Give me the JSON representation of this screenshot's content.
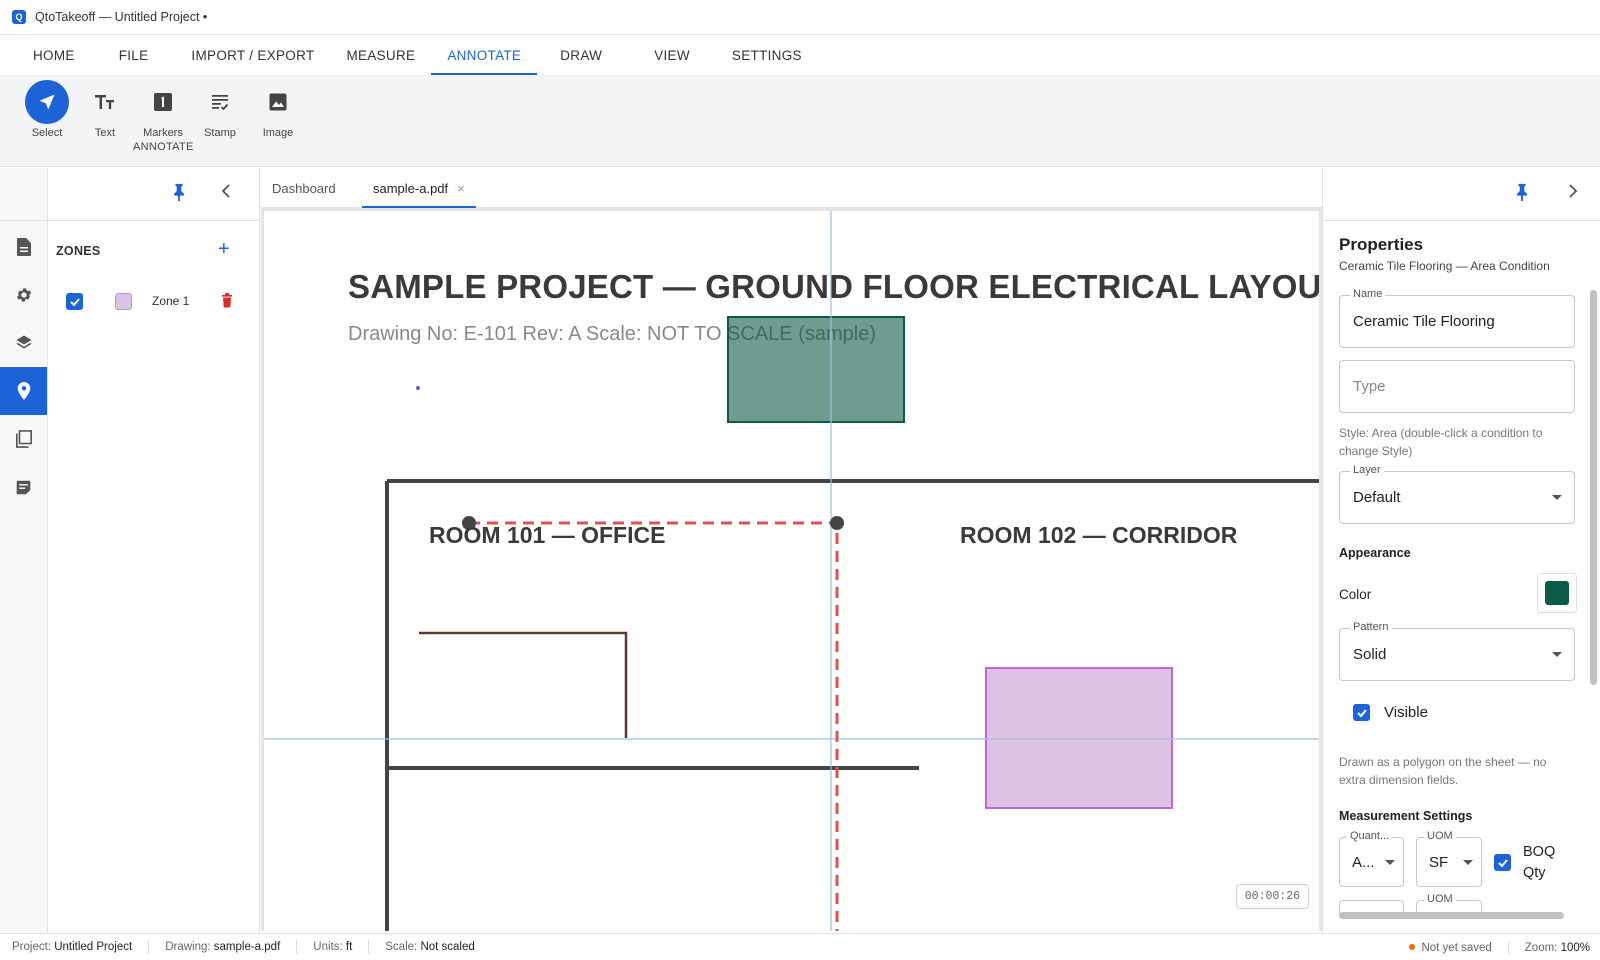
{
  "window": {
    "title": "QtoTakeoff — Untitled Project •",
    "logo_letter": "Q"
  },
  "menu": {
    "tabs": [
      "HOME",
      "FILE",
      "IMPORT / EXPORT",
      "MEASURE",
      "ANNOTATE",
      "DRAW",
      "VIEW",
      "SETTINGS"
    ],
    "active": "ANNOTATE"
  },
  "ribbon": {
    "group_label": "ANNOTATE",
    "buttons": [
      {
        "label": "Select",
        "icon": "navigation-arrow-icon",
        "active": true
      },
      {
        "label": "Text",
        "icon": "text-size-icon"
      },
      {
        "label": "Markers",
        "icon": "marker-1-icon"
      },
      {
        "label": "Stamp",
        "icon": "stamp-icon"
      },
      {
        "label": "Image",
        "icon": "image-icon"
      }
    ]
  },
  "left_rail": {
    "items": [
      "document-icon",
      "settings-icon",
      "layers-icon",
      "location-pin-icon",
      "pages-icon",
      "notes-icon"
    ],
    "active": "location-pin-icon"
  },
  "zones": {
    "header": "ZONES",
    "items": [
      {
        "name": "Zone 1",
        "visible": true,
        "color": "#dcc3e6"
      }
    ]
  },
  "doc_tabs": {
    "tabs": [
      {
        "label": "Dashboard"
      },
      {
        "label": "sample-a.pdf",
        "closable": true,
        "active": true
      }
    ]
  },
  "sheet": {
    "title": "SAMPLE PROJECT — GROUND FLOOR ELECTRICAL LAYOU",
    "subtitle": "Drawing No: E-101   Rev: A   Scale: NOT TO SCALE (sample)",
    "rooms": [
      "ROOM 101 — OFFICE",
      "ROOM 102 — CORRIDOR"
    ],
    "timer": "00:00:26"
  },
  "properties": {
    "title": "Properties",
    "subtitle": "Ceramic Tile Flooring — Area Condition",
    "name_label": "Name",
    "name_value": "Ceramic Tile Flooring",
    "type_placeholder": "Type",
    "style_help": "Style: Area (double-click a condition to change Style)",
    "layer_label": "Layer",
    "layer_value": "Default",
    "appearance_header": "Appearance",
    "color_label": "Color",
    "color_value": "#0e5a48",
    "pattern_label": "Pattern",
    "pattern_value": "Solid",
    "visible_label": "Visible",
    "visible": true,
    "polygon_help": "Drawn as a polygon on the sheet — no extra dimension fields.",
    "measure_header": "Measurement Settings",
    "quantity_label": "Quant...",
    "quantity_value": "A...",
    "uom_label": "UOM",
    "uom_value": "SF",
    "uom2_label": "UOM",
    "boq_label_1": "BOQ",
    "boq_label_2": "Qty",
    "boq_checked": true
  },
  "status": {
    "project_label": "Project:",
    "project_value": "Untitled Project",
    "drawing_label": "Drawing:",
    "drawing_value": "sample-a.pdf",
    "units_label": "Units:",
    "units_value": "ft",
    "scale_label": "Scale:",
    "scale_value": "Not scaled",
    "save_status": "Not yet saved",
    "zoom_label": "Zoom:",
    "zoom_value": "100%"
  },
  "colors": {
    "accent": "#1d63d8",
    "measure_line": "#e0504f",
    "area_green": "#0e5a48",
    "zone_pink": "#dcc3e6",
    "delete_red": "#d32f2f"
  }
}
